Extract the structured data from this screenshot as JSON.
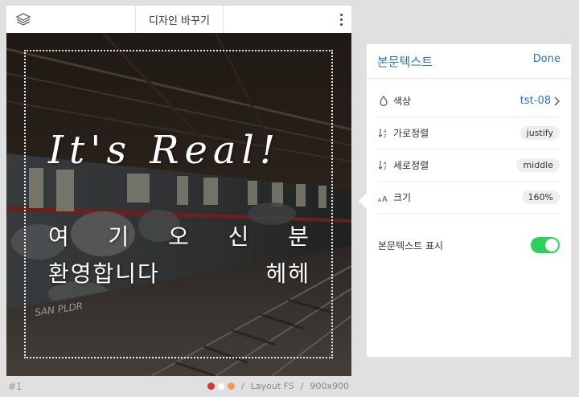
{
  "header": {
    "title": "디자인 바꾸기"
  },
  "canvas": {
    "headline": "It's Real!",
    "body_line_1": "여 기 오 신 분",
    "body_line_2": "환영합니다 헤헤",
    "graffiti": "SAN PLDR"
  },
  "footer": {
    "page_number": "#1",
    "layout": "Layout FS",
    "size": "900x900",
    "separator": "/",
    "swatches": [
      "#d8352f",
      "#ffffff",
      "#f19a5a"
    ]
  },
  "panel": {
    "title": "본문텍스트",
    "done": "Done",
    "rows": [
      {
        "icon": "droplet-icon",
        "label": "색상",
        "value": "tst-08"
      },
      {
        "icon": "sort-icon",
        "label": "가로정렬",
        "value": "justify"
      },
      {
        "icon": "sort-icon",
        "label": "세로정렬",
        "value": "middle"
      },
      {
        "icon": "font-size-icon",
        "label": "크기",
        "value": "160%"
      }
    ],
    "toggle": {
      "label": "본문텍스트 표시",
      "on": true
    }
  },
  "colors": {
    "accent": "#2a74b8",
    "toggle_on": "#2ed158"
  }
}
